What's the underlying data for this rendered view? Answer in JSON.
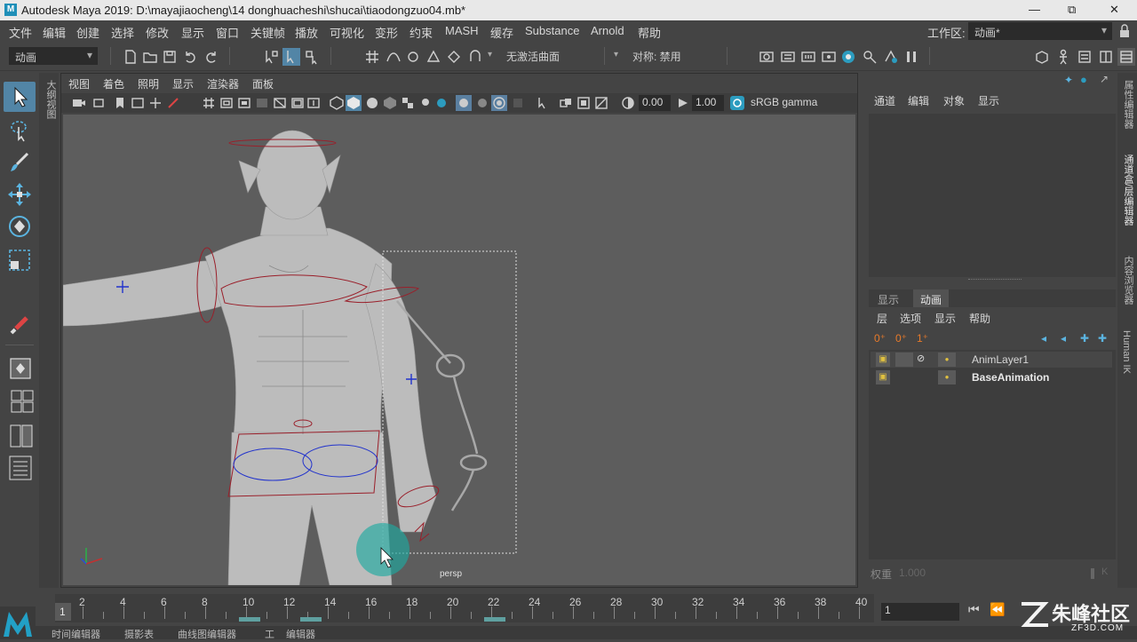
{
  "titlebar": {
    "logo": "M",
    "title": "Autodesk Maya 2019: D:\\mayajiaocheng\\14 donghuacheshi\\shucai\\tiaodongzuo04.mb*",
    "minimize": "—",
    "restore": "⧉",
    "close": "✕"
  },
  "menubar": {
    "items": [
      "文件",
      "编辑",
      "创建",
      "选择",
      "修改",
      "显示",
      "窗口",
      "关键帧",
      "播放",
      "可视化",
      "变形",
      "约束",
      "MASH",
      "缓存",
      "Substance",
      "Arnold",
      "帮助"
    ],
    "workspace_label": "工作区:",
    "workspace_value": "动画*"
  },
  "statusline": {
    "menuset": "动画",
    "live_surface": "无激活曲面",
    "symmetry": "对称: 禁用"
  },
  "panel": {
    "menus": [
      "视图",
      "着色",
      "照明",
      "显示",
      "渲染器",
      "面板"
    ],
    "exposure": "0.00",
    "gamma": "1.00",
    "colorspace": "sRGB gamma",
    "camera_label": "persp"
  },
  "left_strip_label": "大纲视图",
  "channelbox": {
    "menus": [
      "通道",
      "编辑",
      "对象",
      "显示"
    ]
  },
  "layer_editor": {
    "tabs": [
      "显示",
      "动画"
    ],
    "active_tab": "动画",
    "menus": [
      "层",
      "选项",
      "显示",
      "帮助"
    ],
    "layers": [
      {
        "name": "AnimLayer1",
        "bold": false
      },
      {
        "name": "BaseAnimation",
        "bold": true
      }
    ],
    "weight_label": "权重",
    "weight_value": "1.000",
    "k_label": "K"
  },
  "right_strip": {
    "tabs": [
      "属性编辑器",
      "通道盒/层编辑器",
      "内容浏览器",
      "Human IK"
    ]
  },
  "timeline": {
    "ticks": [
      "2",
      "4",
      "6",
      "8",
      "10",
      "12",
      "14",
      "16",
      "18",
      "20",
      "22",
      "24",
      "26",
      "28",
      "30",
      "32",
      "34",
      "36",
      "38",
      "40"
    ],
    "current_frame": "1",
    "current_field": "1"
  },
  "bottombar": {
    "items": [
      "时间编辑器",
      "摄影表",
      "曲线图编辑器",
      "工",
      "编辑器"
    ]
  },
  "watermark": {
    "text": "朱峰社区",
    "sub": "ZF3D.COM"
  },
  "colors": {
    "accent": "#5285a6",
    "viewport_bg": "#5d5d5d",
    "control_red": "#9a1f2a",
    "control_blue": "#2233cc"
  }
}
